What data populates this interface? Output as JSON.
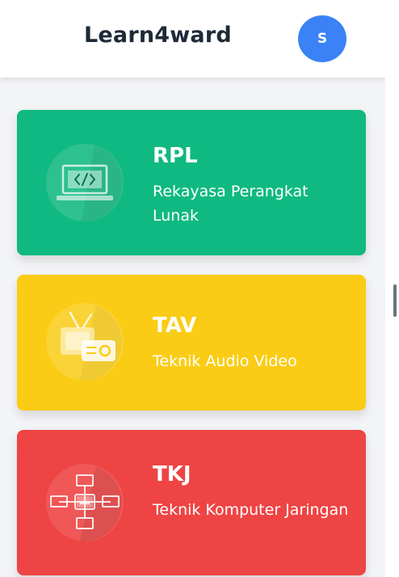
{
  "header": {
    "brand": "Learn4ward",
    "avatar_initial": "S"
  },
  "cards": [
    {
      "code": "RPL",
      "name": "Rekayasa Perangkat Lunak",
      "color": "#10b981",
      "icon": "laptop-code-icon"
    },
    {
      "code": "TAV",
      "name": "Teknik Audio Video",
      "color": "#facc15",
      "icon": "radio-tv-icon"
    },
    {
      "code": "TKJ",
      "name": "Teknik Komputer Jaringan",
      "color": "#ef4444",
      "icon": "network-icon"
    }
  ],
  "colors": {
    "background": "#f3f4f6",
    "header": "#ffffff",
    "brand_text": "#1f2937",
    "avatar": "#3b82f6"
  }
}
